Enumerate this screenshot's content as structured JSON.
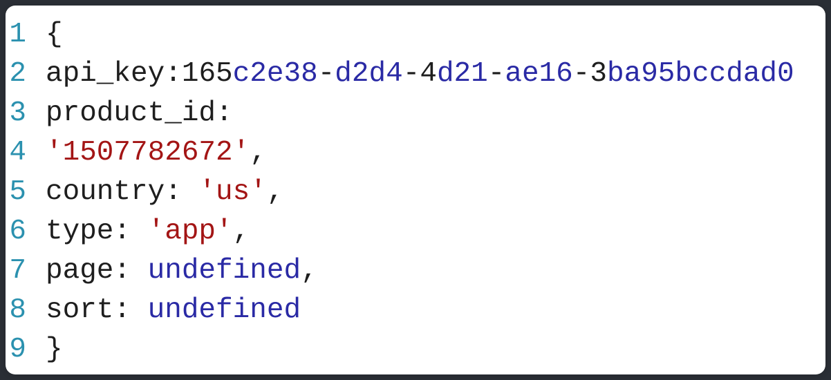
{
  "code": {
    "lines": [
      {
        "num": "1",
        "tokens": [
          {
            "cls": "t-punct",
            "text": "{"
          }
        ]
      },
      {
        "num": "2",
        "tokens": [
          {
            "cls": "t-default",
            "text": "api_key:"
          },
          {
            "cls": "t-number",
            "text": "165"
          },
          {
            "cls": "t-hex",
            "text": "c2e38"
          },
          {
            "cls": "t-default",
            "text": "-"
          },
          {
            "cls": "t-hex",
            "text": "d2d4"
          },
          {
            "cls": "t-default",
            "text": "-"
          },
          {
            "cls": "t-number",
            "text": "4"
          },
          {
            "cls": "t-hex",
            "text": "d21"
          },
          {
            "cls": "t-default",
            "text": "-"
          },
          {
            "cls": "t-hex",
            "text": "ae16"
          },
          {
            "cls": "t-default",
            "text": "-"
          },
          {
            "cls": "t-number",
            "text": "3"
          },
          {
            "cls": "t-hex",
            "text": "ba95bccdad0"
          }
        ]
      },
      {
        "num": "3",
        "tokens": [
          {
            "cls": "t-default",
            "text": "product_id:"
          }
        ]
      },
      {
        "num": "4",
        "tokens": [
          {
            "cls": "t-string",
            "text": "'1507782672'"
          },
          {
            "cls": "t-punct",
            "text": ","
          }
        ]
      },
      {
        "num": "5",
        "tokens": [
          {
            "cls": "t-default",
            "text": "country: "
          },
          {
            "cls": "t-string",
            "text": "'us'"
          },
          {
            "cls": "t-punct",
            "text": ","
          }
        ]
      },
      {
        "num": "6",
        "tokens": [
          {
            "cls": "t-default",
            "text": "type: "
          },
          {
            "cls": "t-string",
            "text": "'app'"
          },
          {
            "cls": "t-punct",
            "text": ","
          }
        ]
      },
      {
        "num": "7",
        "tokens": [
          {
            "cls": "t-default",
            "text": "page: "
          },
          {
            "cls": "t-keyword",
            "text": "undefined"
          },
          {
            "cls": "t-punct",
            "text": ","
          }
        ]
      },
      {
        "num": "8",
        "tokens": [
          {
            "cls": "t-default",
            "text": "sort: "
          },
          {
            "cls": "t-keyword",
            "text": "undefined"
          }
        ]
      },
      {
        "num": "9",
        "tokens": [
          {
            "cls": "t-punct",
            "text": "}"
          }
        ]
      }
    ]
  }
}
